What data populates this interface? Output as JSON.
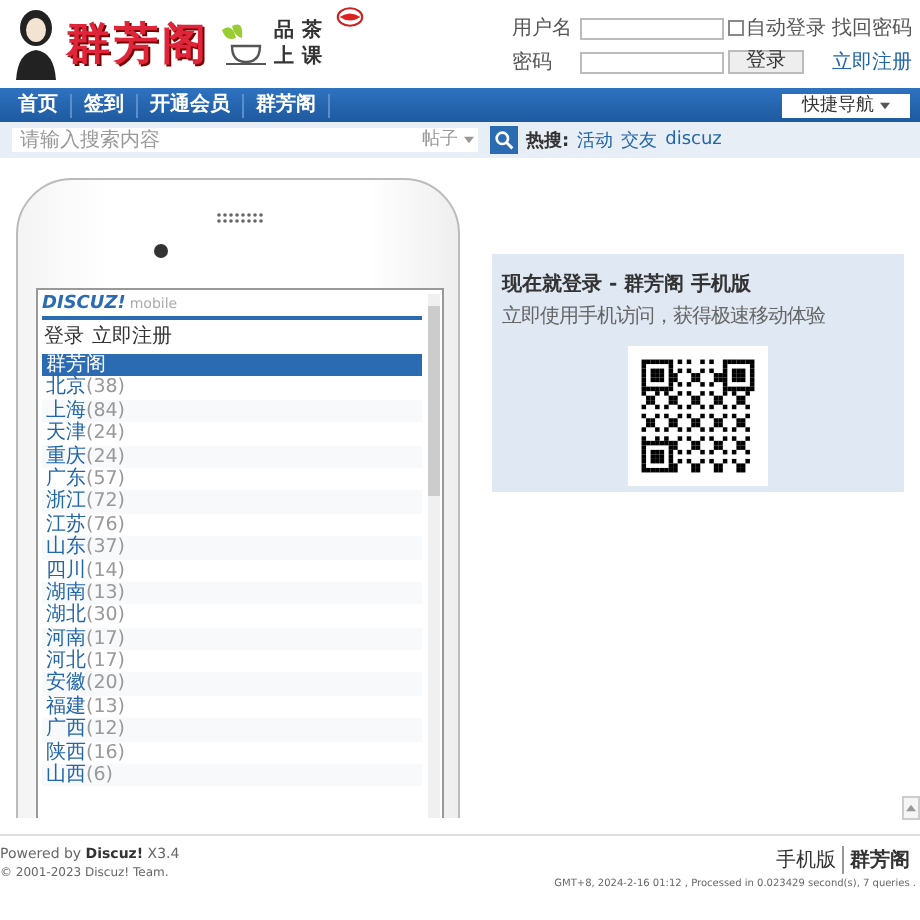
{
  "header": {
    "logo": {
      "title": "群芳阁",
      "tagline_top": "品茶",
      "tagline_bottom": "上课"
    },
    "login": {
      "username_label": "用户名",
      "auto_login": {
        "label": "自动登录",
        "checked": false
      },
      "forgot_link": "找回密码",
      "password_label": "密码",
      "login_button": "登录",
      "register_link": "立即注册"
    }
  },
  "nav": {
    "items": [
      "首页",
      "签到",
      "开通会员",
      "群芳阁"
    ],
    "quick_nav": "快捷导航"
  },
  "search": {
    "placeholder": "请输入搜索内容",
    "scope": "帖子",
    "hot_label": "热搜:",
    "hot_links": [
      "活动",
      "交友",
      "discuz"
    ]
  },
  "phone": {
    "brand": "DISCUZ!",
    "brand_sub": "mobile",
    "links": [
      "登录",
      "立即注册"
    ],
    "rows": [
      {
        "name": "群芳阁",
        "count": "",
        "selected": true
      },
      {
        "name": "北京",
        "count": "(38)",
        "selected": false
      },
      {
        "name": "上海",
        "count": "(84)",
        "selected": false
      },
      {
        "name": "天津",
        "count": "(24)",
        "selected": false
      },
      {
        "name": "重庆",
        "count": "(24)",
        "selected": false
      },
      {
        "name": "广东",
        "count": "(57)",
        "selected": false
      },
      {
        "name": "浙江",
        "count": "(72)",
        "selected": false
      },
      {
        "name": "江苏",
        "count": "(76)",
        "selected": false
      },
      {
        "name": "山东",
        "count": "(37)",
        "selected": false
      },
      {
        "name": "四川",
        "count": "(14)",
        "selected": false
      },
      {
        "name": "湖南",
        "count": "(13)",
        "selected": false
      },
      {
        "name": "湖北",
        "count": "(30)",
        "selected": false
      },
      {
        "name": "河南",
        "count": "(17)",
        "selected": false
      },
      {
        "name": "河北",
        "count": "(17)",
        "selected": false
      },
      {
        "name": "安徽",
        "count": "(20)",
        "selected": false
      },
      {
        "name": "福建",
        "count": "(13)",
        "selected": false
      },
      {
        "name": "广西",
        "count": "(12)",
        "selected": false
      },
      {
        "name": "陕西",
        "count": "(16)",
        "selected": false
      },
      {
        "name": "山西",
        "count": "(6)",
        "selected": false
      }
    ]
  },
  "mobile_panel": {
    "title": "现在就登录 - 群芳阁 手机版",
    "subtitle": "立即使用手机访问，获得极速移动体验"
  },
  "footer": {
    "powered": "Powered by **Discuz!** X3.4",
    "copyright": "© 2001-2023 Discuz! Team.",
    "links": [
      "手机版",
      "群芳阁"
    ],
    "stats": "GMT+8, 2024-2-16 01:12 , Processed in 0.023429 second(s), 7 queries ."
  }
}
